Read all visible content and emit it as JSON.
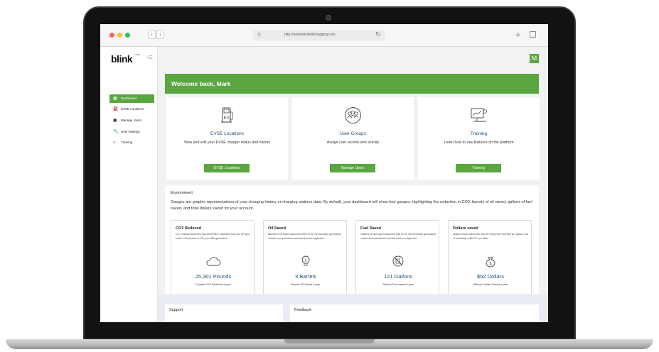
{
  "browser": {
    "url": "http://network.blinkcharging.com",
    "dots": [
      "#ff5f57",
      "#febc2e",
      "#28c840"
    ]
  },
  "sidebar": {
    "logo": "blink",
    "logo_sub": "Host",
    "collapse": "<☰",
    "items": [
      {
        "label": "Dashboard",
        "icon": "dashboard-icon"
      },
      {
        "label": "EVSE Locations",
        "icon": "ev-charger-icon"
      },
      {
        "label": "Manage Users",
        "icon": "users-icon"
      },
      {
        "label": "Host Settings",
        "icon": "wrench-icon"
      },
      {
        "label": "Training",
        "icon": "graduation-cap-icon"
      }
    ]
  },
  "header": {
    "avatar": "M"
  },
  "welcome": "Welcome back, Mark",
  "cards": [
    {
      "title": "EVSE Locations",
      "desc": "View and edit your EVSE charger status and history",
      "button": "EVSE Locations",
      "icon": "ev-charger-icon"
    },
    {
      "title": "User Groups",
      "desc": "Assign user access and activity",
      "button": "Manage Users",
      "icon": "user-groups-icon"
    },
    {
      "title": "Training",
      "desc": "Learn how to use features on the platform",
      "button": "Training",
      "icon": "presentation-icon"
    }
  ],
  "environment": {
    "title": "Environment",
    "desc": "Gauges are graphic representations of your charging history or charging stations data. By default, your dashboard will show four gauges, highlighting the reduction in CO2, barrels of oil saved, gallons of fuel saved, and total dollars saved for your account.",
    "gauges": [
      {
        "title": "CO2 Reduced",
        "desc": "CO, reduced assumes that an EVSE's electricity from the US grid emits 1.53 pounds of CO, per kWh generated.",
        "value": "25,301 Pounds",
        "unit": "Pounds CO2 Reduced a year",
        "icon": "cloud-icon"
      },
      {
        "title": "Oil Saved",
        "desc": "Barrels of oil saved assumes that 1% of US electricity generation comes from petroleum and can thus be neglected.",
        "value": "3 Barrels",
        "unit": "Barrels Oil Saved a year",
        "icon": "lightbulb-icon"
      },
      {
        "title": "Fuel Saved",
        "desc": "Gallons of fuel saved assumes that 1% of US electricity generation comes from petroleum and can thus be neglected",
        "value": "121 Gallons",
        "unit": "Gallons Fuel saved a year",
        "icon": "no-gas-icon"
      },
      {
        "title": "Dollars saved",
        "desc": "Dollars Saved assumes that the fuel price is $2.529 per gallon cost of electricity is $0.147 per kWh.",
        "value": "$62 Dollars",
        "unit": "Millions Dollars Saved a year",
        "icon": "money-bag-icon"
      }
    ]
  },
  "footer": {
    "support": "Support",
    "feedback": "Feedback"
  },
  "colors": {
    "brand_green": "#5aa641",
    "title_blue": "#1e4e79"
  }
}
